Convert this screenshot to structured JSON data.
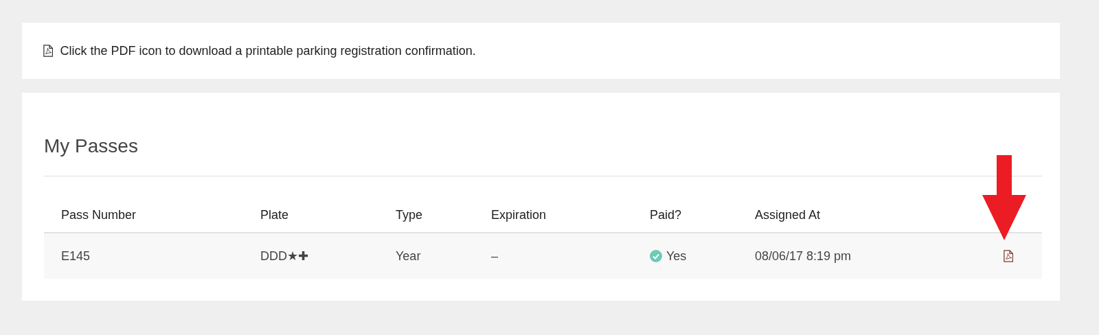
{
  "notice": {
    "text": "Click the PDF icon to download a printable parking registration confirmation."
  },
  "passes": {
    "title": "My Passes",
    "columns": [
      "Pass Number",
      "Plate",
      "Type",
      "Expiration",
      "Paid?",
      "Assigned At"
    ],
    "rows": [
      {
        "pass_number": "E145",
        "plate": "DDD★✚",
        "type": "Year",
        "expiration": "–",
        "paid": true,
        "paid_text": "Yes",
        "assigned_at": "08/06/17 8:19 pm"
      }
    ]
  }
}
